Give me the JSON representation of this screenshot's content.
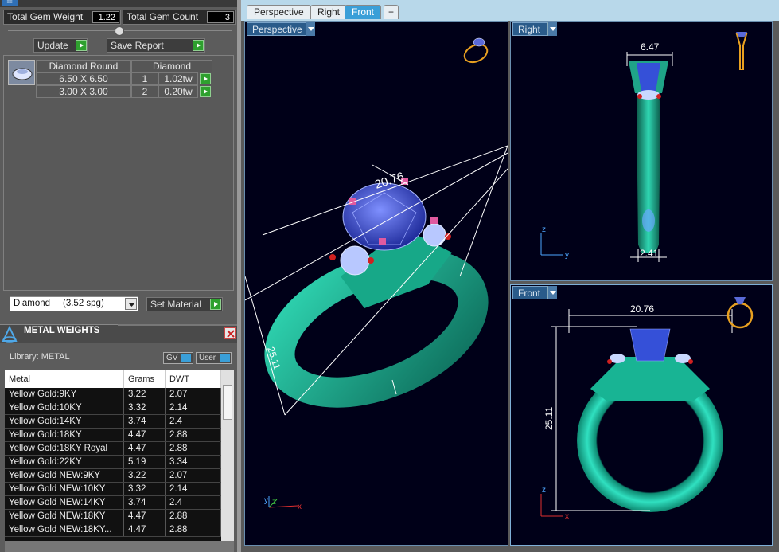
{
  "header": {
    "menu_icon": "menu-icon"
  },
  "gems": {
    "total_weight_label": "Total Gem Weight",
    "total_weight_value": "1.22",
    "total_count_label": "Total Gem Count",
    "total_count_value": "3",
    "update_label": "Update",
    "save_report_label": "Save Report",
    "table": {
      "header": [
        "Diamond Round",
        "Diamond"
      ],
      "rows": [
        {
          "size": "6.50 X 6.50",
          "count": "1",
          "weight": "1.02tw"
        },
        {
          "size": "3.00 X 3.00",
          "count": "2",
          "weight": "0.20tw"
        }
      ]
    }
  },
  "material": {
    "select_value": "Diamond     (3.52 spg)",
    "set_material_label": "Set Material"
  },
  "metal": {
    "title": "METAL WEIGHTS",
    "library_label": "Library: METAL",
    "gv_label": "GV",
    "user_label": "User",
    "columns": [
      "Metal",
      "Grams",
      "DWT"
    ],
    "rows": [
      [
        "Yellow Gold:9KY",
        "3.22",
        "2.07"
      ],
      [
        "Yellow Gold:10KY",
        "3.32",
        "2.14"
      ],
      [
        "Yellow Gold:14KY",
        "3.74",
        "2.4"
      ],
      [
        "Yellow Gold:18KY",
        "4.47",
        "2.88"
      ],
      [
        "Yellow Gold:18KY Royal",
        "4.47",
        "2.88"
      ],
      [
        "Yellow Gold:22KY",
        "5.19",
        "3.34"
      ],
      [
        "Yellow Gold NEW:9KY",
        "3.22",
        "2.07"
      ],
      [
        "Yellow Gold NEW:10KY",
        "3.32",
        "2.14"
      ],
      [
        "Yellow Gold NEW:14KY",
        "3.74",
        "2.4"
      ],
      [
        "Yellow Gold NEW:18KY",
        "4.47",
        "2.88"
      ],
      [
        "Yellow Gold NEW:18KY...",
        "4.47",
        "2.88"
      ]
    ]
  },
  "tabs": [
    "Perspective",
    "Right",
    "Front",
    "+"
  ],
  "active_tab": "Front",
  "views": {
    "perspective": {
      "label": "Perspective",
      "dim_width": "20.76",
      "dim_height": "25.11"
    },
    "right": {
      "label": "Right",
      "dim_top": "6.47",
      "dim_bottom": "2.41",
      "axis_z": "z",
      "axis_y": "y"
    },
    "front": {
      "label": "Front",
      "dim_width": "20.76",
      "dim_height": "25.11",
      "axis_z": "z",
      "axis_x": "x"
    },
    "persp_axes": {
      "y": "y",
      "z": "z",
      "x": "x"
    }
  },
  "colors": {
    "metal": "#1fb89a",
    "gem": "#3a4fd0",
    "accent_ui": "#3a9fd8",
    "dim_line": "#ffffff",
    "side_stone": "#cfe0ff",
    "prong_pink": "#e05aa0"
  }
}
